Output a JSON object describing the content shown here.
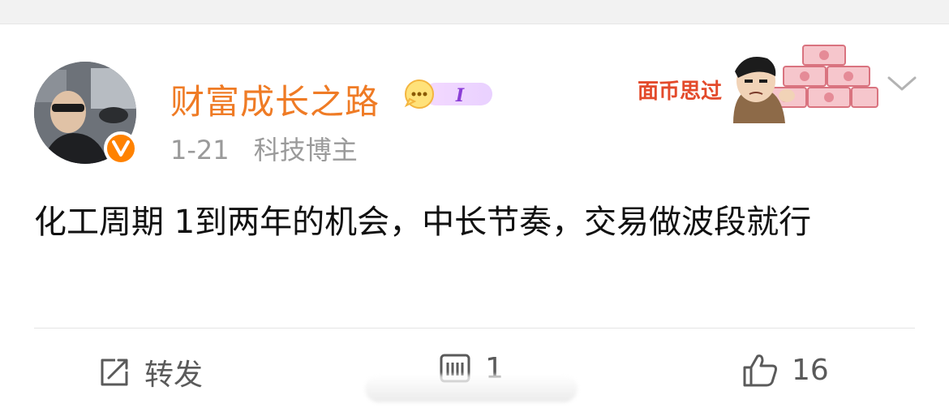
{
  "post": {
    "username": "财富成长之路",
    "level_badge_text": "I",
    "date": "1-21",
    "category": "科技博主",
    "content": "化工周期 1到两年的机会，中长节奏，交易做波段就行",
    "decoration_text": "面币思过"
  },
  "actions": {
    "repost_label": "转发",
    "comment_count": "1",
    "like_count": "16"
  },
  "colors": {
    "username": "#ef7b25",
    "verified_badge": "#ff8200",
    "meta": "#9a9a9a",
    "body_text": "#111111"
  },
  "icons": [
    "verified-v-icon",
    "level-badge-icon",
    "chevron-down-icon",
    "repost-icon",
    "comment-icon",
    "like-icon"
  ]
}
